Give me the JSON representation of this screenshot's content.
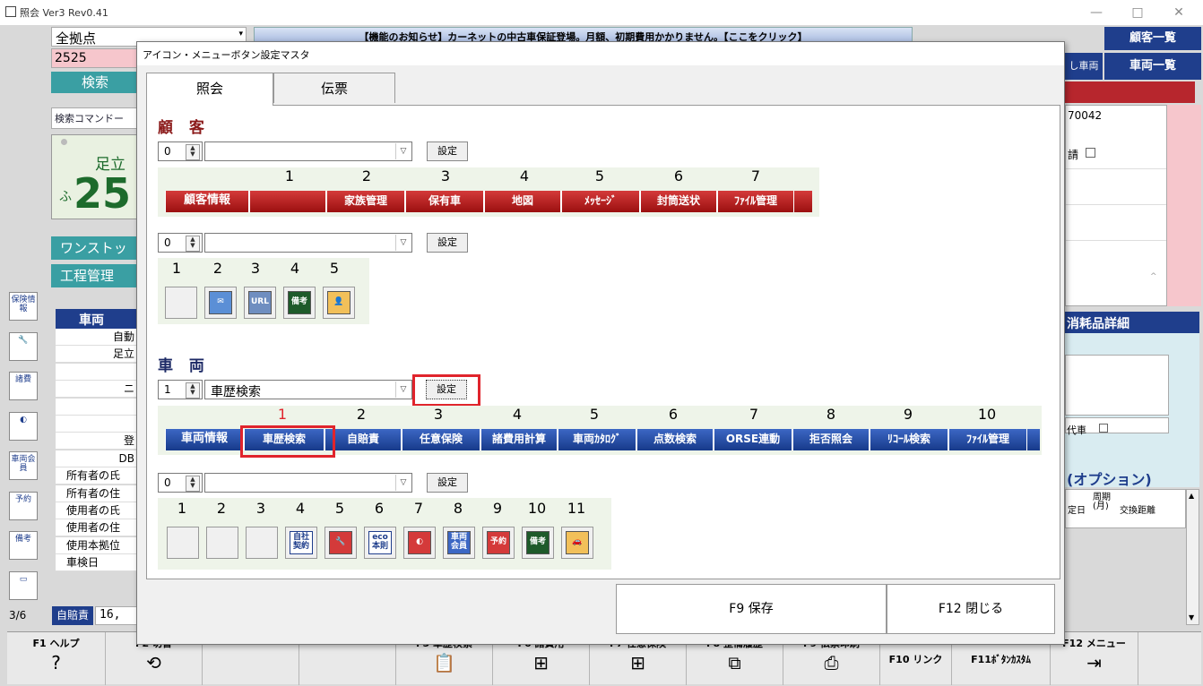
{
  "window": {
    "title": "照会 Ver3 Rev0.41",
    "min": "—",
    "max": "□",
    "close": "✕"
  },
  "background": {
    "branch_select": "全拠点",
    "customer_no": "2525",
    "search_label": "検索",
    "search_cmd_label": "検索コマンドー",
    "plate_area": "足立",
    "plate_kana": "ふ",
    "plate_number": "25",
    "onestop_label": "ワンストッ",
    "process_label": "工程管理",
    "notice": "【機能のお知らせ】カーネットの中古車保証登場。月額、初期費用かかりません。【ここをクリック】",
    "customer_list_btn": "顧客一覧",
    "vehicle_list_btn": "車両一覧",
    "nashi_vehicle": "し車両",
    "right_field_1": "70042",
    "right_apply": "請",
    "consumables_title": "消耗品詳細",
    "daisha": "代車",
    "option_title": "(オプション)",
    "option_cols": [
      "定日",
      "周期\n(月)",
      "交換距離"
    ],
    "vehicle_header": "車両",
    "rows": [
      "自動",
      "足立",
      "",
      "ニ",
      "",
      "",
      "登",
      "DB",
      "所有者の氏",
      "所有者の住",
      "使用者の氏",
      "使用者の住",
      "使用本拠位",
      "車検日"
    ],
    "page_indicator": "3/6",
    "jibai_label": "自賠責",
    "jibai_value": "16,"
  },
  "side_icons": [
    "保険情報",
    "wrench",
    "諸費",
    "gauge",
    "車両会員",
    "予約",
    "備考",
    "folder"
  ],
  "fkeys": [
    {
      "label": "F1 ヘルプ",
      "icon": "?"
    },
    {
      "label": "F2 切替",
      "icon": "⟲"
    },
    {
      "label": "",
      "icon": ""
    },
    {
      "label": "",
      "icon": ""
    },
    {
      "label": "F5 車歴検索",
      "icon": "📋"
    },
    {
      "label": "F6 諸費用",
      "icon": "⊞"
    },
    {
      "label": "F7 任意保険",
      "icon": "⊞"
    },
    {
      "label": "F8 整備履歴",
      "icon": "⧉"
    },
    {
      "label": "F9 伝票印刷",
      "icon": "⎙"
    },
    {
      "label": "F10 リンク",
      "icon": ""
    },
    {
      "label": "F11ﾎﾞﾀﾝｶｽﾀﾑ",
      "icon": ""
    },
    {
      "label": "F12 メニュー",
      "icon": "⇥"
    }
  ],
  "dialog": {
    "title": "アイコン・メニューボタン設定マスタ",
    "tabs": [
      "照会",
      "伝票"
    ],
    "customer_section": "顧 客",
    "vehicle_section": "車 両",
    "set_label": "設定",
    "customer_menu": {
      "spin": "0",
      "combo": "",
      "numbers": [
        "1",
        "2",
        "3",
        "4",
        "5",
        "6",
        "7"
      ],
      "header": "顧客情報",
      "buttons": [
        "",
        "家族管理",
        "保有車",
        "地図",
        "ﾒｯｾｰｼﾞ",
        "封筒送状",
        "ﾌｧｲﾙ管理"
      ]
    },
    "customer_icons": {
      "spin": "0",
      "combo": "",
      "numbers": [
        "1",
        "2",
        "3",
        "4",
        "5"
      ],
      "icons": [
        "empty",
        "mail-icon",
        "URL",
        "備考",
        "person-folder-icon"
      ]
    },
    "vehicle_menu": {
      "spin": "1",
      "combo": "車歴検索",
      "numbers": [
        "1",
        "2",
        "3",
        "4",
        "5",
        "6",
        "7",
        "8",
        "9",
        "10"
      ],
      "header": "車両情報",
      "buttons": [
        "車歴検索",
        "自賠責",
        "任意保険",
        "諸費用計算",
        "車両ｶﾀﾛｸﾞ",
        "点数検索",
        "ORSE連動",
        "拒否照会",
        "ﾘｺｰﾙ検索",
        "ﾌｧｲﾙ管理"
      ]
    },
    "vehicle_icons": {
      "spin": "0",
      "combo": "",
      "numbers": [
        "1",
        "2",
        "3",
        "4",
        "5",
        "6",
        "7",
        "8",
        "9",
        "10",
        "11"
      ],
      "icons": [
        "empty",
        "empty",
        "empty",
        "自社契約",
        "wrench-icon",
        "eco本則",
        "gauge-icon",
        "車両会員",
        "予約",
        "備考",
        "car-folder-icon"
      ]
    },
    "save_btn": "F9 保存",
    "close_btn": "F12 閉じる"
  }
}
